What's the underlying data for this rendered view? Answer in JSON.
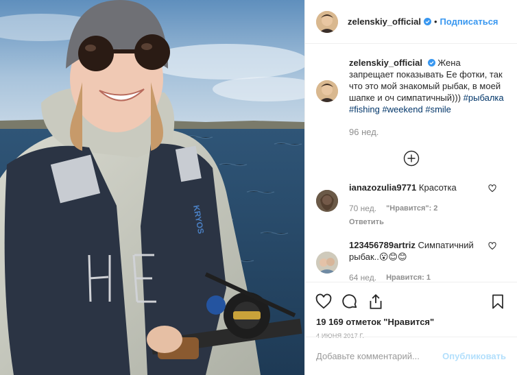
{
  "header": {
    "username": "zelenskiy_official",
    "separator": "•",
    "follow_label": "Подписаться"
  },
  "caption": {
    "username": "zelenskiy_official",
    "text": "Жена запрещает показывать Ее фотки, так что это мой знакомый рыбак, в моей шапке и оч симпатичный)))",
    "hashtags": [
      "#рыбалка",
      "#fishing",
      "#weekend",
      "#smile"
    ],
    "age": "96 нед."
  },
  "comments": [
    {
      "username": "ianazozulia9771",
      "text": "Красотка",
      "time": "70 нед.",
      "likes": "\"Нравится\": 2",
      "reply": "Ответить"
    },
    {
      "username": "123456789artriz",
      "text": "Симпатичний рыбак..😮😊😊",
      "time": "64 нед.",
      "likes": "Нравится: 1"
    }
  ],
  "actions": {
    "like_icon": "heart-icon",
    "comment_icon": "comment-icon",
    "share_icon": "share-icon",
    "save_icon": "bookmark-icon"
  },
  "likes_text": "19 169 отметок \"Нравится\"",
  "date": "4 июня 2017 г.",
  "add_comment": {
    "placeholder": "Добавьте комментарий...",
    "publish_label": "Опубликовать"
  },
  "colors": {
    "link": "#3897f0",
    "hashtag": "#003569",
    "muted": "#8e8e8e",
    "publish_disabled": "#b2dffc"
  }
}
